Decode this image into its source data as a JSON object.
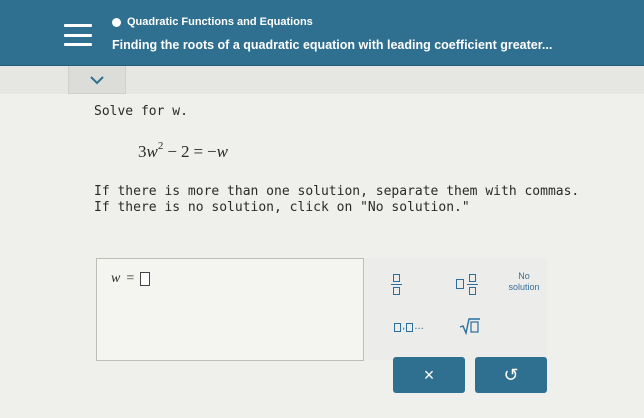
{
  "header": {
    "topic": "Quadratic Functions and Equations",
    "lesson": "Finding the roots of a quadratic equation with leading coefficient greater..."
  },
  "problem": {
    "prompt": "Solve for w.",
    "equation": {
      "coefficient": "3",
      "variable": "w",
      "exponent": "2",
      "minus": "−",
      "constant": "2",
      "equals": "=",
      "rhs_sign": "−",
      "rhs_var": "w"
    },
    "instruction_1": "If there is more than one solution, separate them with commas.",
    "instruction_2": "If there is no solution, click on \"No solution.\""
  },
  "answer": {
    "variable": "w",
    "equals": "="
  },
  "keypad": {
    "keys": [
      "fraction-key",
      "mixed-number-key",
      "no-solution-key",
      "list-key",
      "square-root-key"
    ],
    "no_solution_line1": "No",
    "no_solution_line2": "solution",
    "list_separator": ",",
    "list_ellipsis": "..."
  },
  "actions": {
    "clear_label": "×",
    "undo_label": "↺"
  },
  "colors": {
    "header_bg": "#2f6f8f",
    "key_accent": "#2a6f9e",
    "page_bg": "#efefec"
  }
}
